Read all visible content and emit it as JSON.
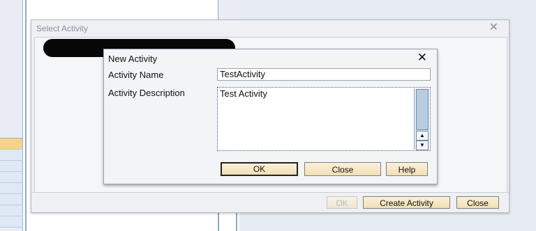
{
  "outer_dialog": {
    "title": "Select Activity",
    "close_glyph": "✕",
    "buttons": {
      "ok": "OK",
      "create_activity": "Create Activity",
      "close": "Close"
    }
  },
  "inner_dialog": {
    "title": "New Activity",
    "close_glyph": "✕",
    "fields": {
      "name_label": "Activity Name",
      "name_value": "TestActivity",
      "description_label": "Activity Description",
      "description_value": "Test Activity"
    },
    "buttons": {
      "ok": "OK",
      "close": "Close",
      "help": "Help"
    },
    "scroll_up_glyph": "▲",
    "scroll_down_glyph": "▼"
  },
  "colors": {
    "button_fill": "#f1dfb4",
    "selection_row": "#f6d28a",
    "frame_blue": "#8ea8c6"
  }
}
